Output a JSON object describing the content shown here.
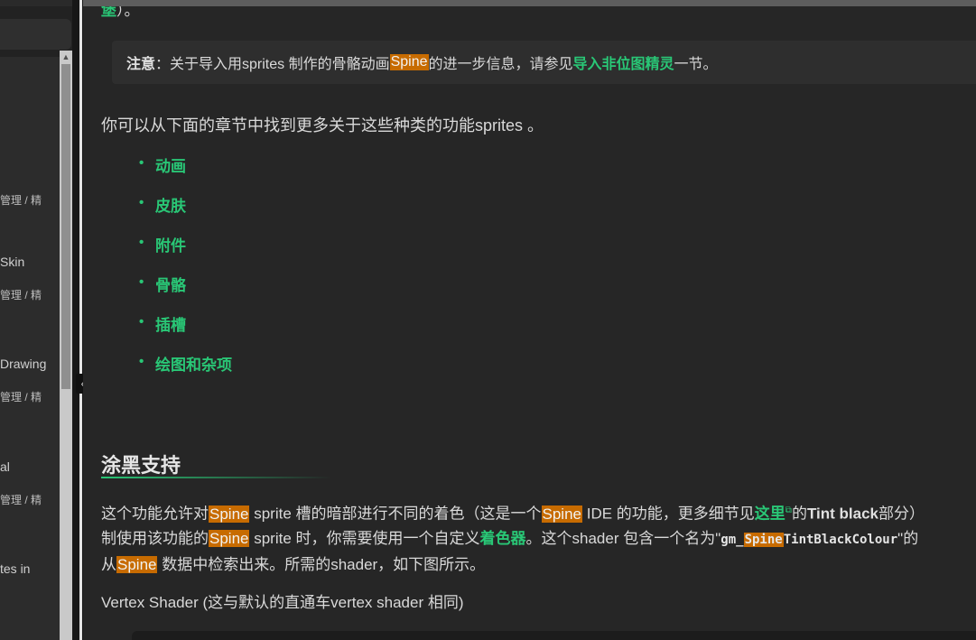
{
  "sidebar": {
    "entries": [
      {
        "label": "",
        "crumb": "管理 / 精"
      },
      {
        "label": "Skin",
        "crumb": "管理 / 精"
      },
      {
        "label": "Drawing",
        "crumb": "管理 / 精"
      },
      {
        "label": "al",
        "crumb": "管理 / 精"
      },
      {
        "label": "tes in",
        "crumb": ""
      }
    ]
  },
  "divider": {
    "collapse_glyph": "«"
  },
  "content": {
    "top_fragment_link": "堡",
    "top_fragment_tail": "）。",
    "note": {
      "label": "注意",
      "text_before": "：关于导入用sprites 制作的骨骼动画",
      "highlight": "Spine",
      "text_middle": " 的进一步信息，请参见",
      "link": "导入非位图精灵",
      "text_after": "一节。"
    },
    "intro": "你可以从下面的章节中找到更多关于这些种类的功能sprites 。",
    "bullets": [
      "动画",
      "皮肤",
      "附件",
      "骨骼",
      "插槽",
      "绘图和杂项"
    ],
    "heading": "涂黑支持",
    "para": {
      "l1_a": "这个功能允许对",
      "hl": "Spine",
      "l1_b": " sprite 槽的暗部进行不同的着色（这是一个",
      "l1_c": " IDE 的功能，更多细节见",
      "l1_link": "这里",
      "l1_d": "的",
      "l1_bold": "Tint black",
      "l1_e": "部分）",
      "l2_a": "制使用该功能的",
      "l2_b": " sprite 时，你需要使用一个自定义",
      "l2_link": "着色器",
      "l2_c": "。这个shader 包含一个名为\"",
      "code_a": "gm_",
      "code_b": "TintBlackColour",
      "l2_d": "\"的",
      "l3_a": "从",
      "l3_b": " 数据中检索出来。所需的shader，如下图所示。"
    },
    "vertex_shader": "Vertex Shader (这与默认的直通车vertex shader 相同)"
  }
}
